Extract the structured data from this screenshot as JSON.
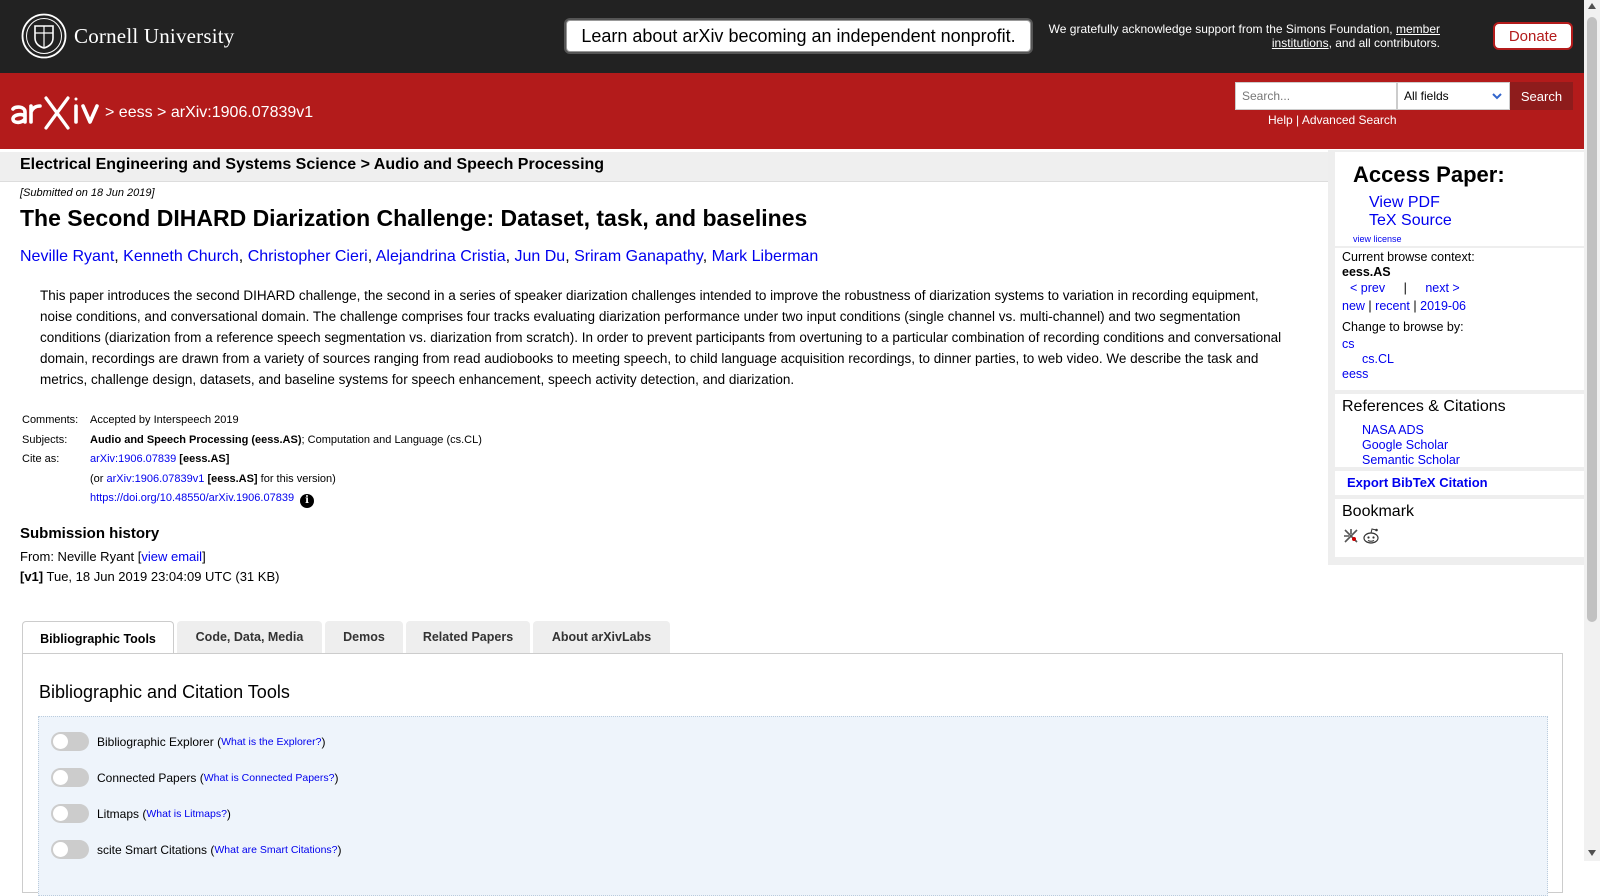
{
  "topbar": {
    "university": "Cornell University",
    "banner": "Learn about arXiv becoming an independent nonprofit.",
    "support_prefix": "We gratefully acknowledge support from the Simons Foundation,",
    "support_link": "member institutions",
    "support_suffix": ", and all contributors.",
    "donate": "Donate"
  },
  "header": {
    "crumb_sep1": ">",
    "crumb_archive": "eess",
    "crumb_sep2": ">",
    "crumb_paper": "arXiv:1906.07839v1",
    "search_placeholder": "Search...",
    "field_selected": "All fields",
    "search_button": "Search",
    "help": "Help",
    "advanced_search": "Advanced Search",
    "link_sep": "|"
  },
  "subheader": "Electrical Engineering and Systems Science > Audio and Speech Processing",
  "paper": {
    "submitted": "[Submitted on 18 Jun 2019]",
    "title": "The Second DIHARD Diarization Challenge: Dataset, task, and baselines",
    "authors": [
      "Neville Ryant",
      "Kenneth Church",
      "Christopher Cieri",
      "Alejandrina Cristia",
      "Jun Du",
      "Sriram Ganapathy",
      "Mark Liberman"
    ],
    "abstract": "This paper introduces the second DIHARD challenge, the second in a series of speaker diarization challenges intended to improve the robustness of diarization systems to variation in recording equipment, noise conditions, and conversational domain. The challenge comprises four tracks evaluating diarization performance under two input conditions (single channel vs. multi-channel) and two segmentation conditions (diarization from a reference speech segmentation vs. diarization from scratch). In order to prevent participants from overtuning to a particular combination of recording conditions and conversational domain, recordings are drawn from a variety of sources ranging from read audiobooks to meeting speech, to child language acquisition recordings, to dinner parties, to web video. We describe the task and metrics, challenge design, datasets, and baseline systems for speech enhancement, speech activity detection, and diarization."
  },
  "meta": {
    "comments_label": "Comments:",
    "comments": "Accepted by Interspeech 2019",
    "subjects_label": "Subjects:",
    "subject_primary": "Audio and Speech Processing (eess.AS)",
    "subject_rest": "; Computation and Language (cs.CL)",
    "cite_label": "Cite as:",
    "cite_id": "arXiv:1906.07839",
    "cite_tag": "[eess.AS]",
    "version_prefix": "(or",
    "version_id": "arXiv:1906.07839v1",
    "version_tag": "[eess.AS]",
    "version_suffix": "for this version)",
    "doi": "https://doi.org/10.48550/arXiv.1906.07839",
    "info_glyph": "i"
  },
  "history": {
    "heading": "Submission history",
    "from_prefix": "From: Neville Ryant [",
    "view_email": "view email",
    "from_suffix": "]",
    "v1_label": "[v1]",
    "v1_text": "Tue, 18 Jun 2019 23:04:09 UTC (31 KB)"
  },
  "sidebar": {
    "access_heading": "Access Paper:",
    "view_pdf": "View PDF",
    "tex_source": "TeX Source",
    "view_license": "view license",
    "context_label": "Current browse context:",
    "context_value": "eess.AS",
    "prev": "< prev",
    "pipe": "|",
    "next": "next >",
    "new": "new",
    "recent": "recent",
    "month": "2019-06",
    "change_label": "Change to browse by:",
    "browse_cs": "cs",
    "browse_cscl": "cs.CL",
    "browse_eess": "eess",
    "refs_heading": "References & Citations",
    "nasa_ads": "NASA ADS",
    "google_scholar": "Google Scholar",
    "semantic_scholar": "Semantic Scholar",
    "bibtex": "Export BibTeX Citation",
    "bookmark_heading": "Bookmark"
  },
  "tabs": [
    "Bibliographic Tools",
    "Code, Data, Media",
    "Demos",
    "Related Papers",
    "About arXivLabs"
  ],
  "panel": {
    "heading": "Bibliographic and Citation Tools",
    "tools": [
      {
        "name": "Bibliographic Explorer",
        "help": "What is the Explorer?"
      },
      {
        "name": "Connected Papers",
        "help": "What is Connected Papers?"
      },
      {
        "name": "Litmaps",
        "help": "What is Litmaps?"
      },
      {
        "name": "scite Smart Citations",
        "help": "What are Smart Citations?"
      }
    ]
  },
  "colors": {
    "arxiv_red": "#b31b1b",
    "topbar": "#222222",
    "link": "#0000ee"
  }
}
